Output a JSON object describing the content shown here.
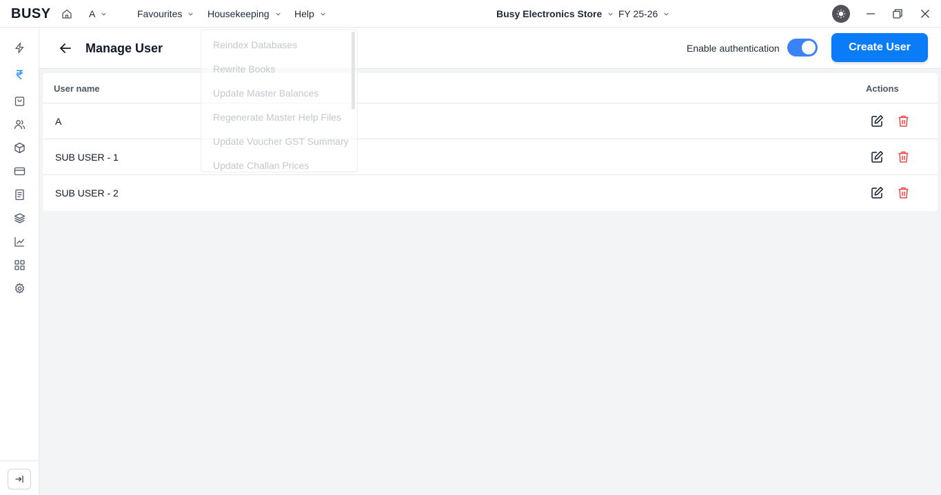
{
  "app": {
    "logo": "BUSY",
    "company_selector": "A",
    "menus": {
      "favourites": "Favourites",
      "housekeeping": "Housekeeping",
      "help": "Help"
    },
    "store_name": "Busy Electronics Store",
    "fiscal_year": "FY 25-26"
  },
  "page": {
    "title": "Manage User",
    "auth_label": "Enable authentication",
    "auth_enabled": true,
    "create_button": "Create User"
  },
  "table": {
    "headers": {
      "user_name": "User name",
      "actions": "Actions"
    },
    "rows": [
      {
        "name": "A"
      },
      {
        "name": "SUB USER - 1"
      },
      {
        "name": "SUB USER - 2"
      }
    ]
  },
  "housekeeping_menu": {
    "items": [
      "Reindex Databases",
      "Rewrite Books",
      "Update Master Balances",
      "Regenerate Master Help Files",
      "Update Voucher GST Summary",
      "Update Challan Prices"
    ]
  },
  "colors": {
    "accent": "#0a7cf7",
    "toggle_on": "#3b82f6",
    "delete": "#ef4444",
    "rupee_active": "#1d8cf8"
  },
  "sidebar": {
    "icons": [
      "lightning-icon",
      "rupee-icon",
      "bag-icon",
      "users-icon",
      "box-icon",
      "card-icon",
      "document-icon",
      "layers-icon",
      "chart-icon",
      "grid-icon",
      "settings-icon"
    ],
    "active": "rupee-icon"
  }
}
